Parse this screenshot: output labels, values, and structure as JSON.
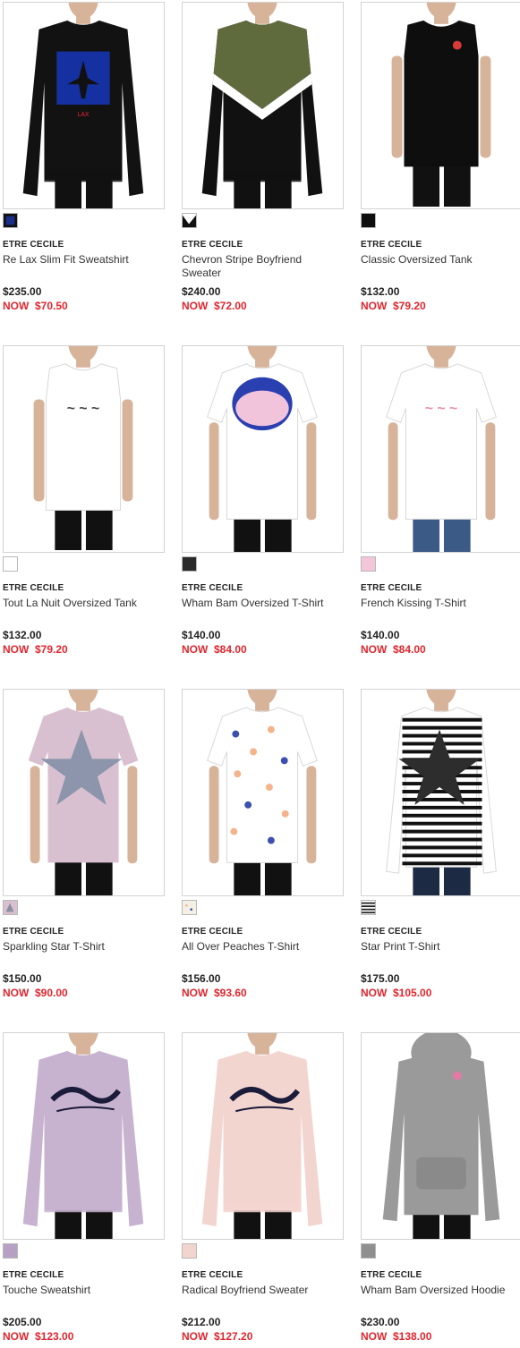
{
  "products": [
    {
      "brand": "ETRE CECILE",
      "name": "Re Lax Slim Fit Sweatshirt",
      "price": "$235.00",
      "sale": "NOW  $70.50",
      "color": "#121212",
      "swatch": "#1a2f8a",
      "accent": "#1530a0",
      "style": "sweatshirt",
      "print": "square"
    },
    {
      "brand": "ETRE CECILE",
      "name": "Chevron Stripe Boyfriend Sweater",
      "price": "$240.00",
      "sale": "NOW  $72.00",
      "color": "#111111",
      "swatch": "#101010",
      "accent": "#5f6a3d",
      "style": "sweatshirt",
      "print": "chevron"
    },
    {
      "brand": "ETRE CECILE",
      "name": "Classic Oversized Tank",
      "price": "$132.00",
      "sale": "NOW  $79.20",
      "color": "#0e0e0e",
      "swatch": "#0e0e0e",
      "accent": "#d93a3a",
      "style": "tank",
      "print": "badge"
    },
    {
      "brand": "ETRE CECILE",
      "name": "Tout La Nuit Oversized Tank",
      "price": "$132.00",
      "sale": "NOW  $79.20",
      "color": "#ffffff",
      "swatch": "#ffffff",
      "accent": "#222222",
      "style": "tank",
      "print": "text"
    },
    {
      "brand": "ETRE CECILE",
      "name": "Wham Bam Oversized T-Shirt",
      "price": "$140.00",
      "sale": "NOW  $84.00",
      "color": "#ffffff",
      "swatch": "#2a2a2a",
      "accent": "#2a3fb0",
      "style": "tee",
      "print": "bubble"
    },
    {
      "brand": "ETRE CECILE",
      "name": "French Kissing T-Shirt",
      "price": "$140.00",
      "sale": "NOW  $84.00",
      "color": "#ffffff",
      "swatch": "#f4c6da",
      "accent": "#e27aa4",
      "style": "tee",
      "print": "text"
    },
    {
      "brand": "ETRE CECILE",
      "name": "Sparkling Star T-Shirt",
      "price": "$150.00",
      "sale": "NOW  $90.00",
      "color": "#d9c0d0",
      "swatch": "#8a8ea0",
      "accent": "#8c95ab",
      "style": "tee",
      "print": "star"
    },
    {
      "brand": "ETRE CECILE",
      "name": "All Over Peaches T-Shirt",
      "price": "$156.00",
      "sale": "NOW  $93.60",
      "color": "#ffffff",
      "swatch": "#f5f0e6",
      "accent": "#f3b48c",
      "style": "tee",
      "print": "dots"
    },
    {
      "brand": "ETRE CECILE",
      "name": "Star Print T-Shirt",
      "price": "$175.00",
      "sale": "NOW  $105.00",
      "color": "#ffffff",
      "swatch": "#333333",
      "accent": "#2d2d2d",
      "style": "longsleeve",
      "print": "stripes-star"
    },
    {
      "brand": "ETRE CECILE",
      "name": "Touche Sweatshirt",
      "price": "$205.00",
      "sale": "NOW  $123.00",
      "color": "#c7b3cf",
      "swatch": "#b6a1c4",
      "accent": "#1b1b3a",
      "style": "sweatshirt",
      "print": "script"
    },
    {
      "brand": "ETRE CECILE",
      "name": "Radical Boyfriend Sweater",
      "price": "$212.00",
      "sale": "NOW  $127.20",
      "color": "#f3d5d0",
      "swatch": "#f3d5d0",
      "accent": "#1b1b3a",
      "style": "sweatshirt",
      "print": "script"
    },
    {
      "brand": "ETRE CECILE",
      "name": "Wham Bam Oversized Hoodie",
      "price": "$230.00",
      "sale": "NOW  $138.00",
      "color": "#9a9a9a",
      "swatch": "#8f8f8f",
      "accent": "#e27aa4",
      "style": "hoodie",
      "print": "badge"
    }
  ]
}
